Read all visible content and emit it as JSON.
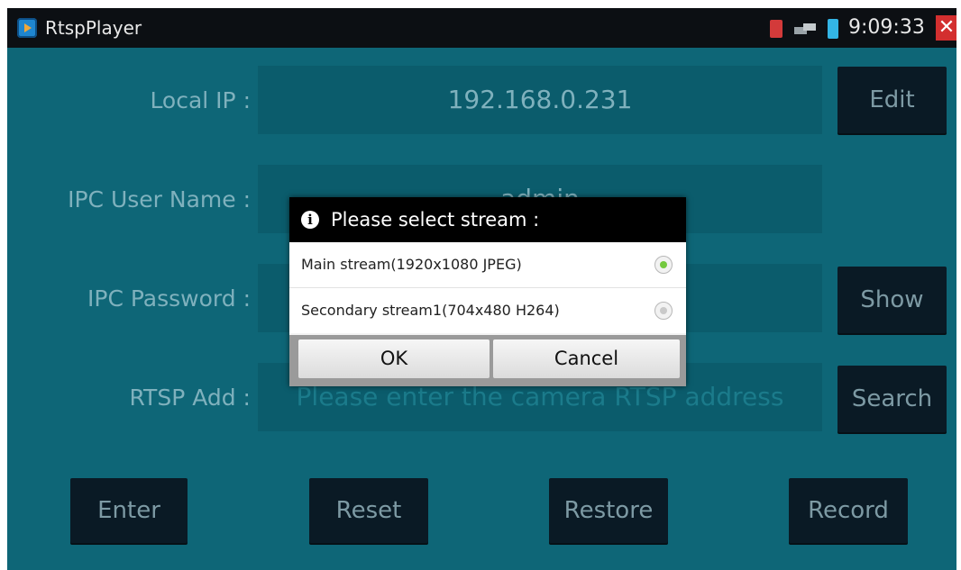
{
  "app": {
    "title": "RtspPlayer",
    "time": "9:09:33"
  },
  "labels": {
    "local_ip": "Local IP :",
    "user_name": "IPC User Name :",
    "password": "IPC Password :",
    "rtsp_add": "RTSP Add :"
  },
  "fields": {
    "local_ip": "192.168.0.231",
    "user_name": "admin",
    "password": "",
    "rtsp_placeholder": "Please enter the camera RTSP address"
  },
  "buttons": {
    "edit": "Edit",
    "show": "Show",
    "search": "Search",
    "enter": "Enter",
    "reset": "Reset",
    "restore": "Restore",
    "record": "Record"
  },
  "dialog": {
    "title": "Please select stream :",
    "options": [
      {
        "label": "Main stream(1920x1080 JPEG)",
        "selected": true
      },
      {
        "label": "Secondary stream1(704x480 H264)",
        "selected": false
      }
    ],
    "ok": "OK",
    "cancel": "Cancel"
  },
  "icons": {
    "info": "i",
    "close": "✕"
  },
  "colors": {
    "background": "#0e6677",
    "titlebar": "#0c0f13",
    "button": "#0a1a25",
    "radio_selected": "#74c93f",
    "close": "#d32f2f"
  }
}
